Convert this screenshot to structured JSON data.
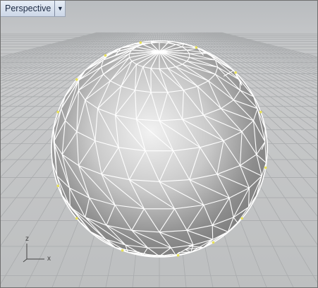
{
  "viewport": {
    "title": "Perspective",
    "dropdown_icon": "triangle-down-icon",
    "background_top": "#b9bcbf",
    "grid_color": "#a9abad",
    "wire_color": "#ffffff",
    "selected_vertex_color": "#e9e25a"
  },
  "axes": {
    "x_label": "x",
    "z_label": "z"
  }
}
